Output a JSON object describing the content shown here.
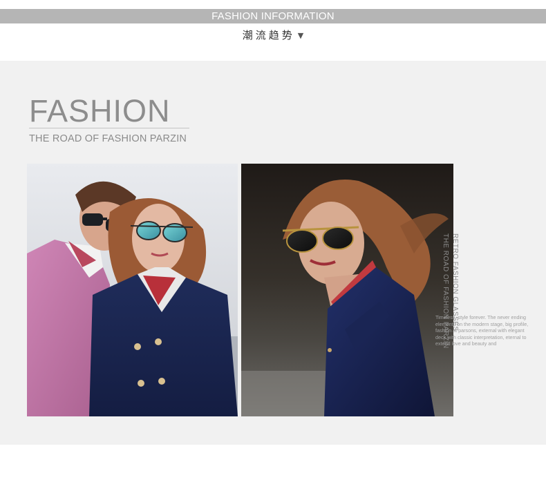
{
  "header": {
    "banner": "FASHION INFORMATION",
    "subtitle": "潮流趋势",
    "dropdown_icon": "triangle-down-icon"
  },
  "section": {
    "title": "FASHION",
    "tagline": "THE ROAD OF FASHION PARZIN"
  },
  "photos": [
    {
      "name": "couple-photo",
      "description_icon": "photo"
    },
    {
      "name": "woman-photo",
      "description_icon": "photo"
    }
  ],
  "side_text": {
    "line1": "RETRO FASHION GLASSES",
    "line2": "THE ROAD OF FASHION PARZIN"
  },
  "body_copy": "Timeless, style forever. The never ending elements on the modern stage, big profile, fashion at parsons, external with elegant deck with classic interpretation, eternal to extend love and beauty and",
  "colors": {
    "banner_bg": "#b5b5b5",
    "panel_bg": "#f1f1f1",
    "title": "#8d8d8d"
  }
}
